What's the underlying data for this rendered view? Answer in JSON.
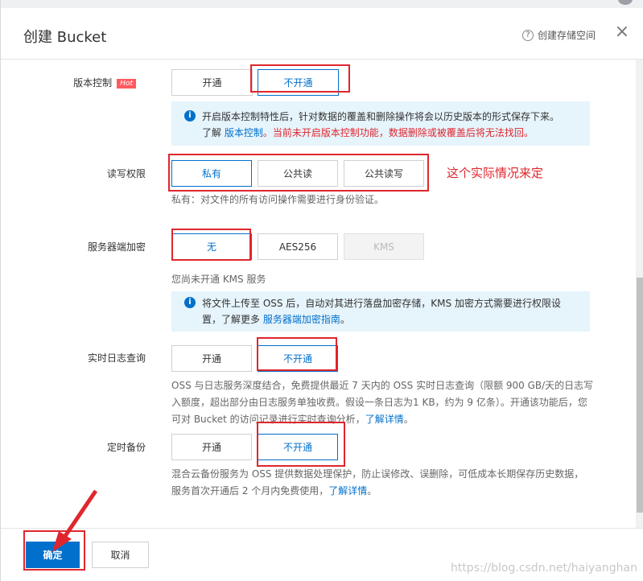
{
  "header": {
    "title": "创建 Bucket",
    "help_label": "创建存储空间",
    "help_icon": "?",
    "close_icon": "×"
  },
  "versioning": {
    "label": "版本控制",
    "badge": "Hot",
    "options": [
      "开通",
      "不开通"
    ],
    "selected": "不开通",
    "info_text": "开启版本控制特性后，针对数据的覆盖和删除操作将会以历史版本的形式保存下来。",
    "info_prefix": "了解",
    "info_link": "版本控制",
    "info_warning": "。当前未开启版本控制功能，数据删除或被覆盖后将无法找回。"
  },
  "acl": {
    "label": "读写权限",
    "options": [
      "私有",
      "公共读",
      "公共读写"
    ],
    "selected": "私有",
    "annotation": "这个实际情况来定",
    "desc": "私有：对文件的所有访问操作需要进行身份验证。"
  },
  "encryption": {
    "label": "服务器端加密",
    "options": [
      "无",
      "AES256",
      "KMS"
    ],
    "selected": "无",
    "disabled": "KMS",
    "kms_note": "您尚未开通 KMS 服务",
    "info_line1": "将文件上传至 OSS 后，自动对其进行落盘加密存储，KMS 加密方式需要进行权限设",
    "info_line2_prefix": "置，了解更多",
    "info_link": "服务器端加密指南",
    "info_line2_suffix": "。"
  },
  "realtime_log": {
    "label": "实时日志查询",
    "options": [
      "开通",
      "不开通"
    ],
    "selected": "不开通",
    "desc_line1": "OSS 与日志服务深度结合，免费提供最近 7 天内的 OSS 实时日志查询（限额 900 GB/天的日志写",
    "desc_line2": "入额度，超出部分由日志服务单独收费。假设一条日志为1 KB，约为 9 亿条）。开通该功能后，您",
    "desc_line3_prefix": "可对 Bucket 的访问记录进行实时查询分析，",
    "desc_link": "了解详情",
    "desc_line3_suffix": "。"
  },
  "backup": {
    "label": "定时备份",
    "options": [
      "开通",
      "不开通"
    ],
    "selected": "不开通",
    "desc_line1": "混合云备份服务为 OSS 提供数据处理保护，防止误修改、误删除，可低成本长期保存历史数据，",
    "desc_line2_prefix": "服务首次开通后 2 个月内免费使用，",
    "desc_link": "了解详情",
    "desc_line2_suffix": "。"
  },
  "footer": {
    "ok_label": "确定",
    "cancel_label": "取消"
  },
  "watermark": "https://blog.csdn.net/haiyanghan",
  "colors": {
    "primary": "#0070cc",
    "annotation_red": "#e0262d",
    "info_bg": "#e6f4fc"
  }
}
